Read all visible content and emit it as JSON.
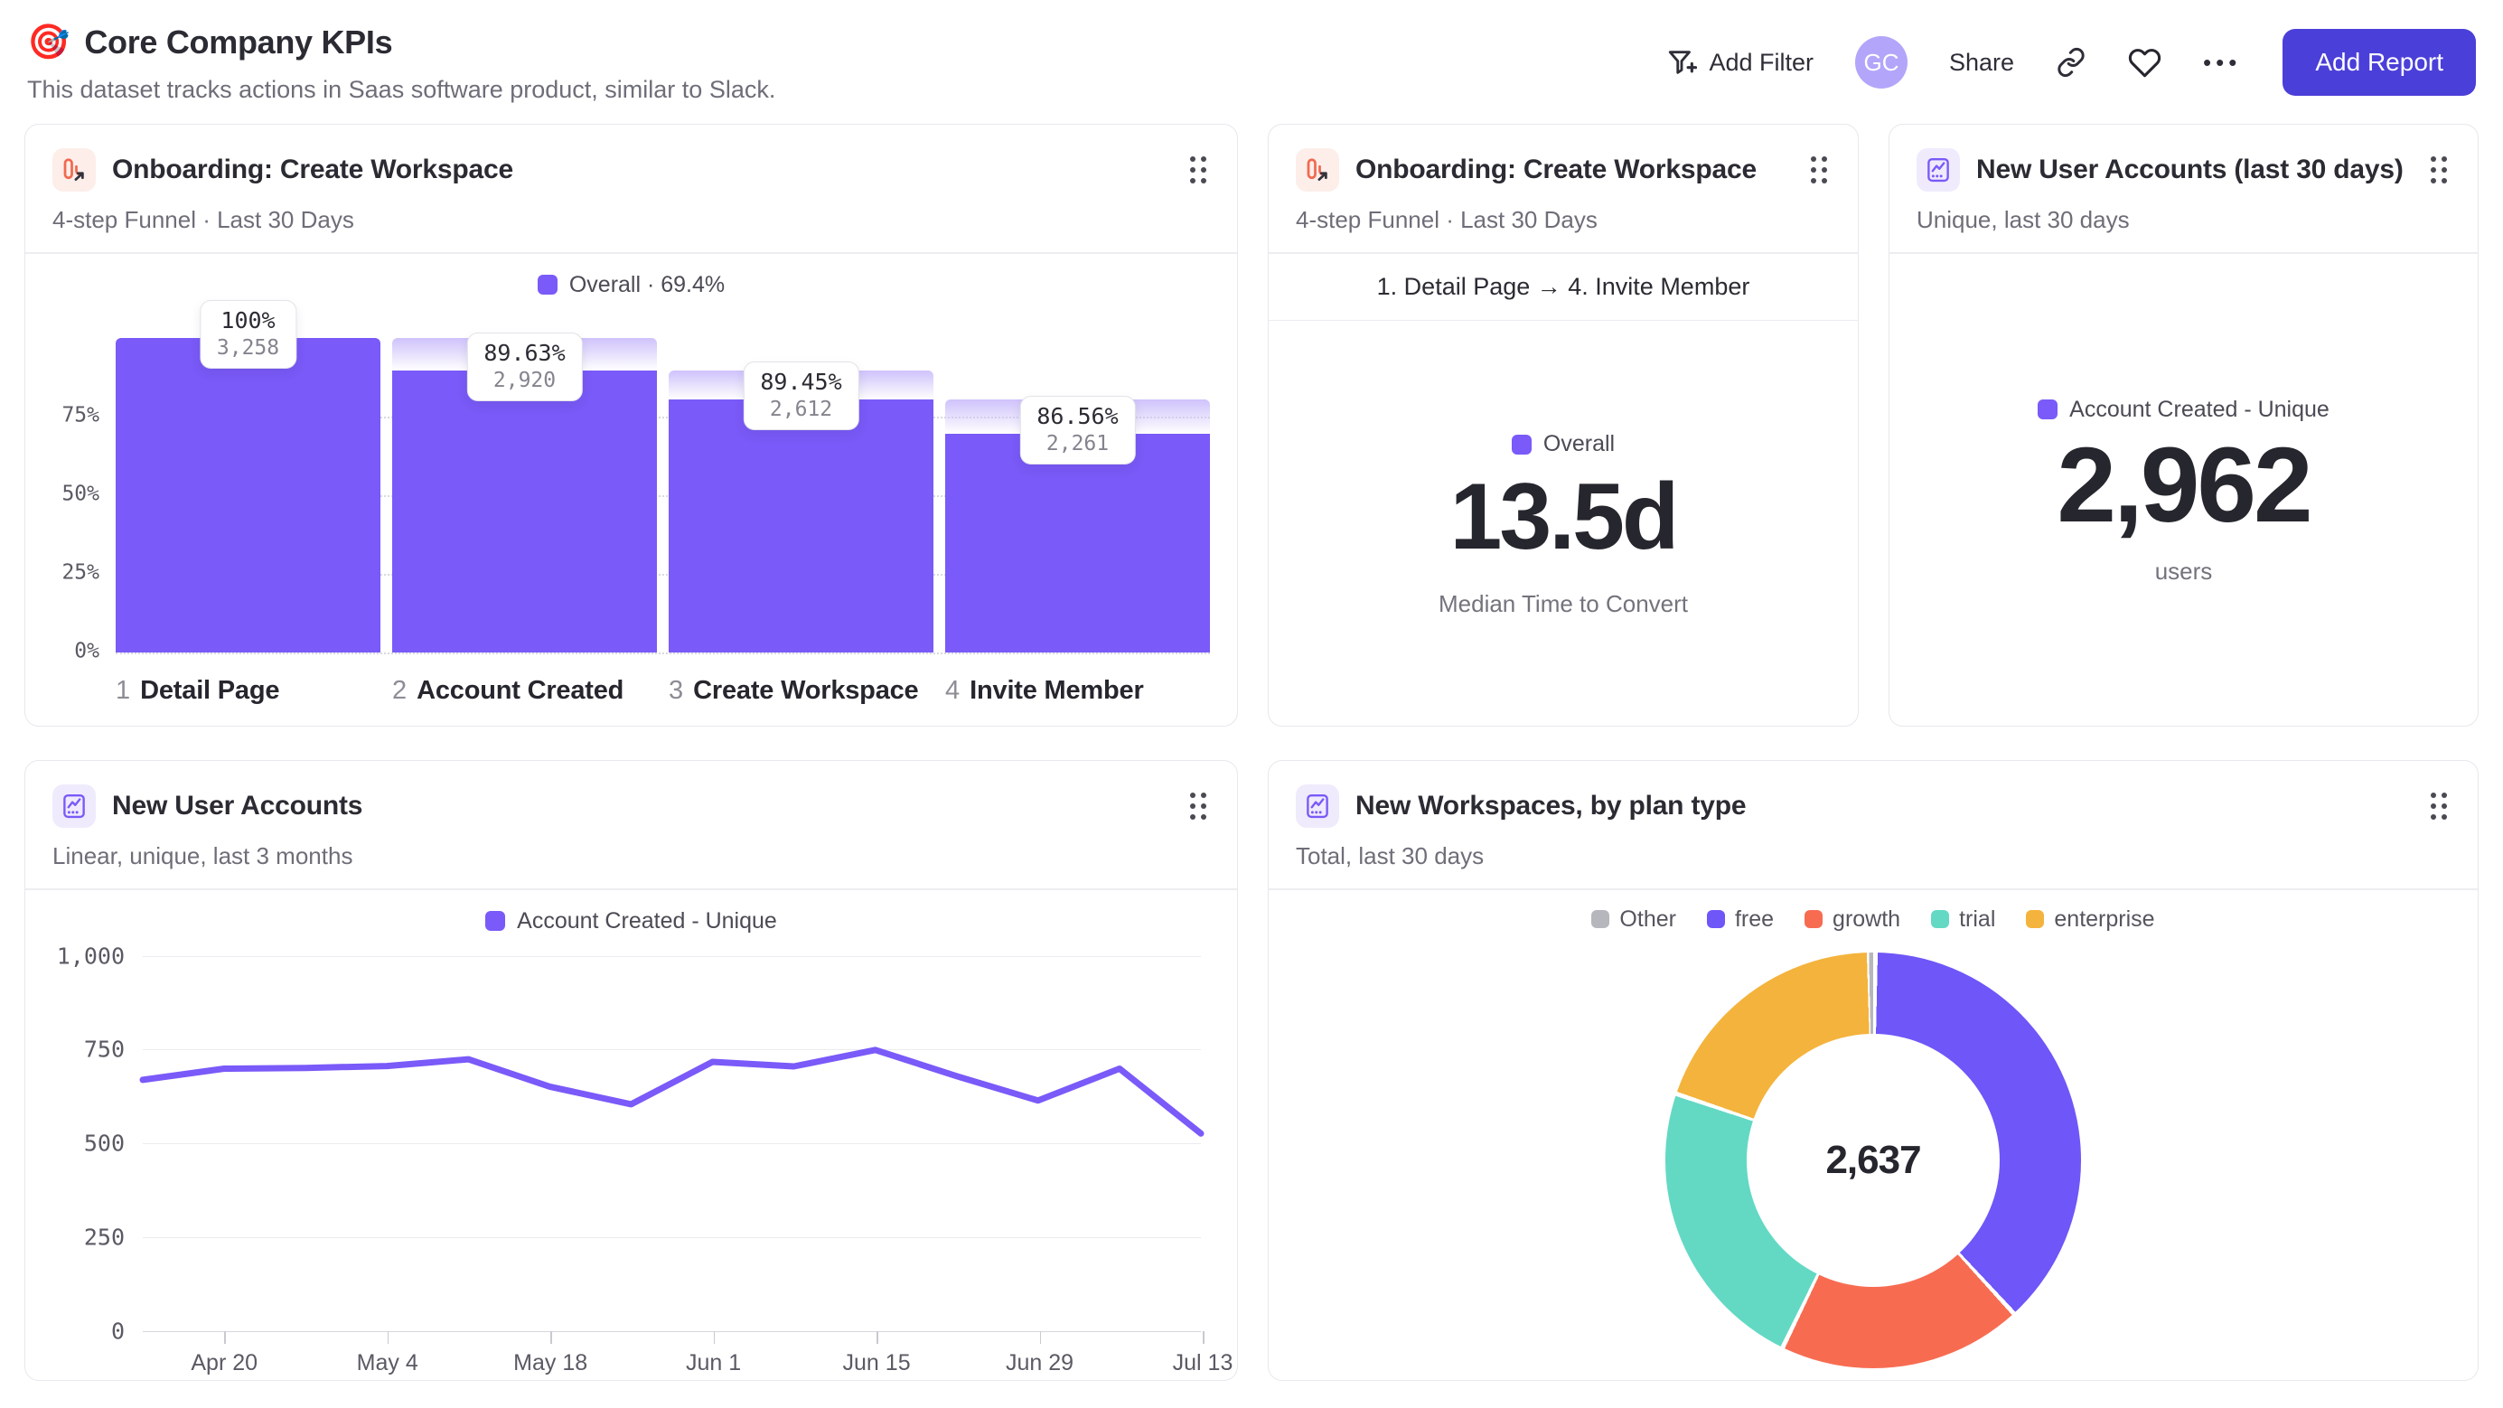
{
  "page": {
    "title_emoji": "🎯",
    "title": "Core Company KPIs",
    "subtitle": "This dataset tracks actions in Saas software product, similar to Slack.",
    "header": {
      "add_filter_label": "Add Filter",
      "avatar_initials": "GC",
      "share_label": "Share",
      "ellipsis": "•••",
      "add_report_label": "Add Report"
    }
  },
  "cards": {
    "funnel": {
      "title": "Onboarding: Create Workspace",
      "subtitle": "4-step Funnel · Last 30 Days",
      "legend": "Overall · 69.4%",
      "chart_data": {
        "type": "bar",
        "title": "Onboarding: Create Workspace funnel",
        "y_ticks": [
          "75%",
          "50%",
          "25%",
          "0%"
        ],
        "ylim": [
          0,
          100
        ],
        "bar_color": "#7a5af8",
        "steps": [
          {
            "index": "1",
            "label": "Detail Page",
            "pct_label": "100%",
            "count_label": "3,258",
            "count": 3258,
            "height_pct": 100
          },
          {
            "index": "2",
            "label": "Account Created",
            "pct_label": "89.63%",
            "count_label": "2,920",
            "count": 2920,
            "height_pct": 89.6
          },
          {
            "index": "3",
            "label": "Create Workspace",
            "pct_label": "89.45%",
            "count_label": "2,612",
            "count": 2612,
            "height_pct": 80.2
          },
          {
            "index": "4",
            "label": "Invite Member",
            "pct_label": "86.56%",
            "count_label": "2,261",
            "count": 2261,
            "height_pct": 69.4
          }
        ]
      }
    },
    "median_time": {
      "title": "Onboarding: Create Workspace",
      "subtitle": "4-step Funnel · Last 30 Days",
      "range_label": "1. Detail Page → 4. Invite Member",
      "legend": "Overall",
      "value": "13.5d",
      "caption": "Median Time to Convert"
    },
    "new_users_30d": {
      "title": "New User Accounts (last 30 days)",
      "subtitle": "Unique, last 30 days",
      "legend": "Account Created - Unique",
      "value": "2,962",
      "caption": "users"
    },
    "new_users_trend": {
      "title": "New User Accounts",
      "subtitle": "Linear, unique, last 3 months",
      "legend": "Account Created - Unique",
      "chart_data": {
        "type": "line",
        "line_color": "#7a5af8",
        "x_labels": [
          "Apr 20",
          "May 4",
          "May 18",
          "Jun 1",
          "Jun 15",
          "Jun 29",
          "Jul 13"
        ],
        "values": [
          670,
          700,
          702,
          707,
          725,
          652,
          605,
          718,
          706,
          750,
          680,
          615,
          700,
          527
        ],
        "y_ticks": [
          1000,
          750,
          500,
          250,
          0
        ],
        "ylim": [
          0,
          1000
        ],
        "grid": true,
        "legend_position": "top-center"
      }
    },
    "workspaces_by_plan": {
      "title": "New Workspaces, by plan type",
      "subtitle": "Total, last 30 days",
      "center_value": "2,637",
      "chart_data": {
        "type": "pie",
        "total": 2637,
        "draw_order": [
          "free",
          "growth",
          "trial",
          "enterprise",
          "Other"
        ],
        "segments": [
          {
            "label": "Other",
            "color": "#b6b6bd",
            "value": 13
          },
          {
            "label": "free",
            "color": "#6e56f8",
            "value": 1002
          },
          {
            "label": "growth",
            "color": "#f76c51",
            "value": 501
          },
          {
            "label": "trial",
            "color": "#63d9c4",
            "value": 607
          },
          {
            "label": "enterprise",
            "color": "#f4b33c",
            "value": 514
          }
        ]
      }
    }
  }
}
